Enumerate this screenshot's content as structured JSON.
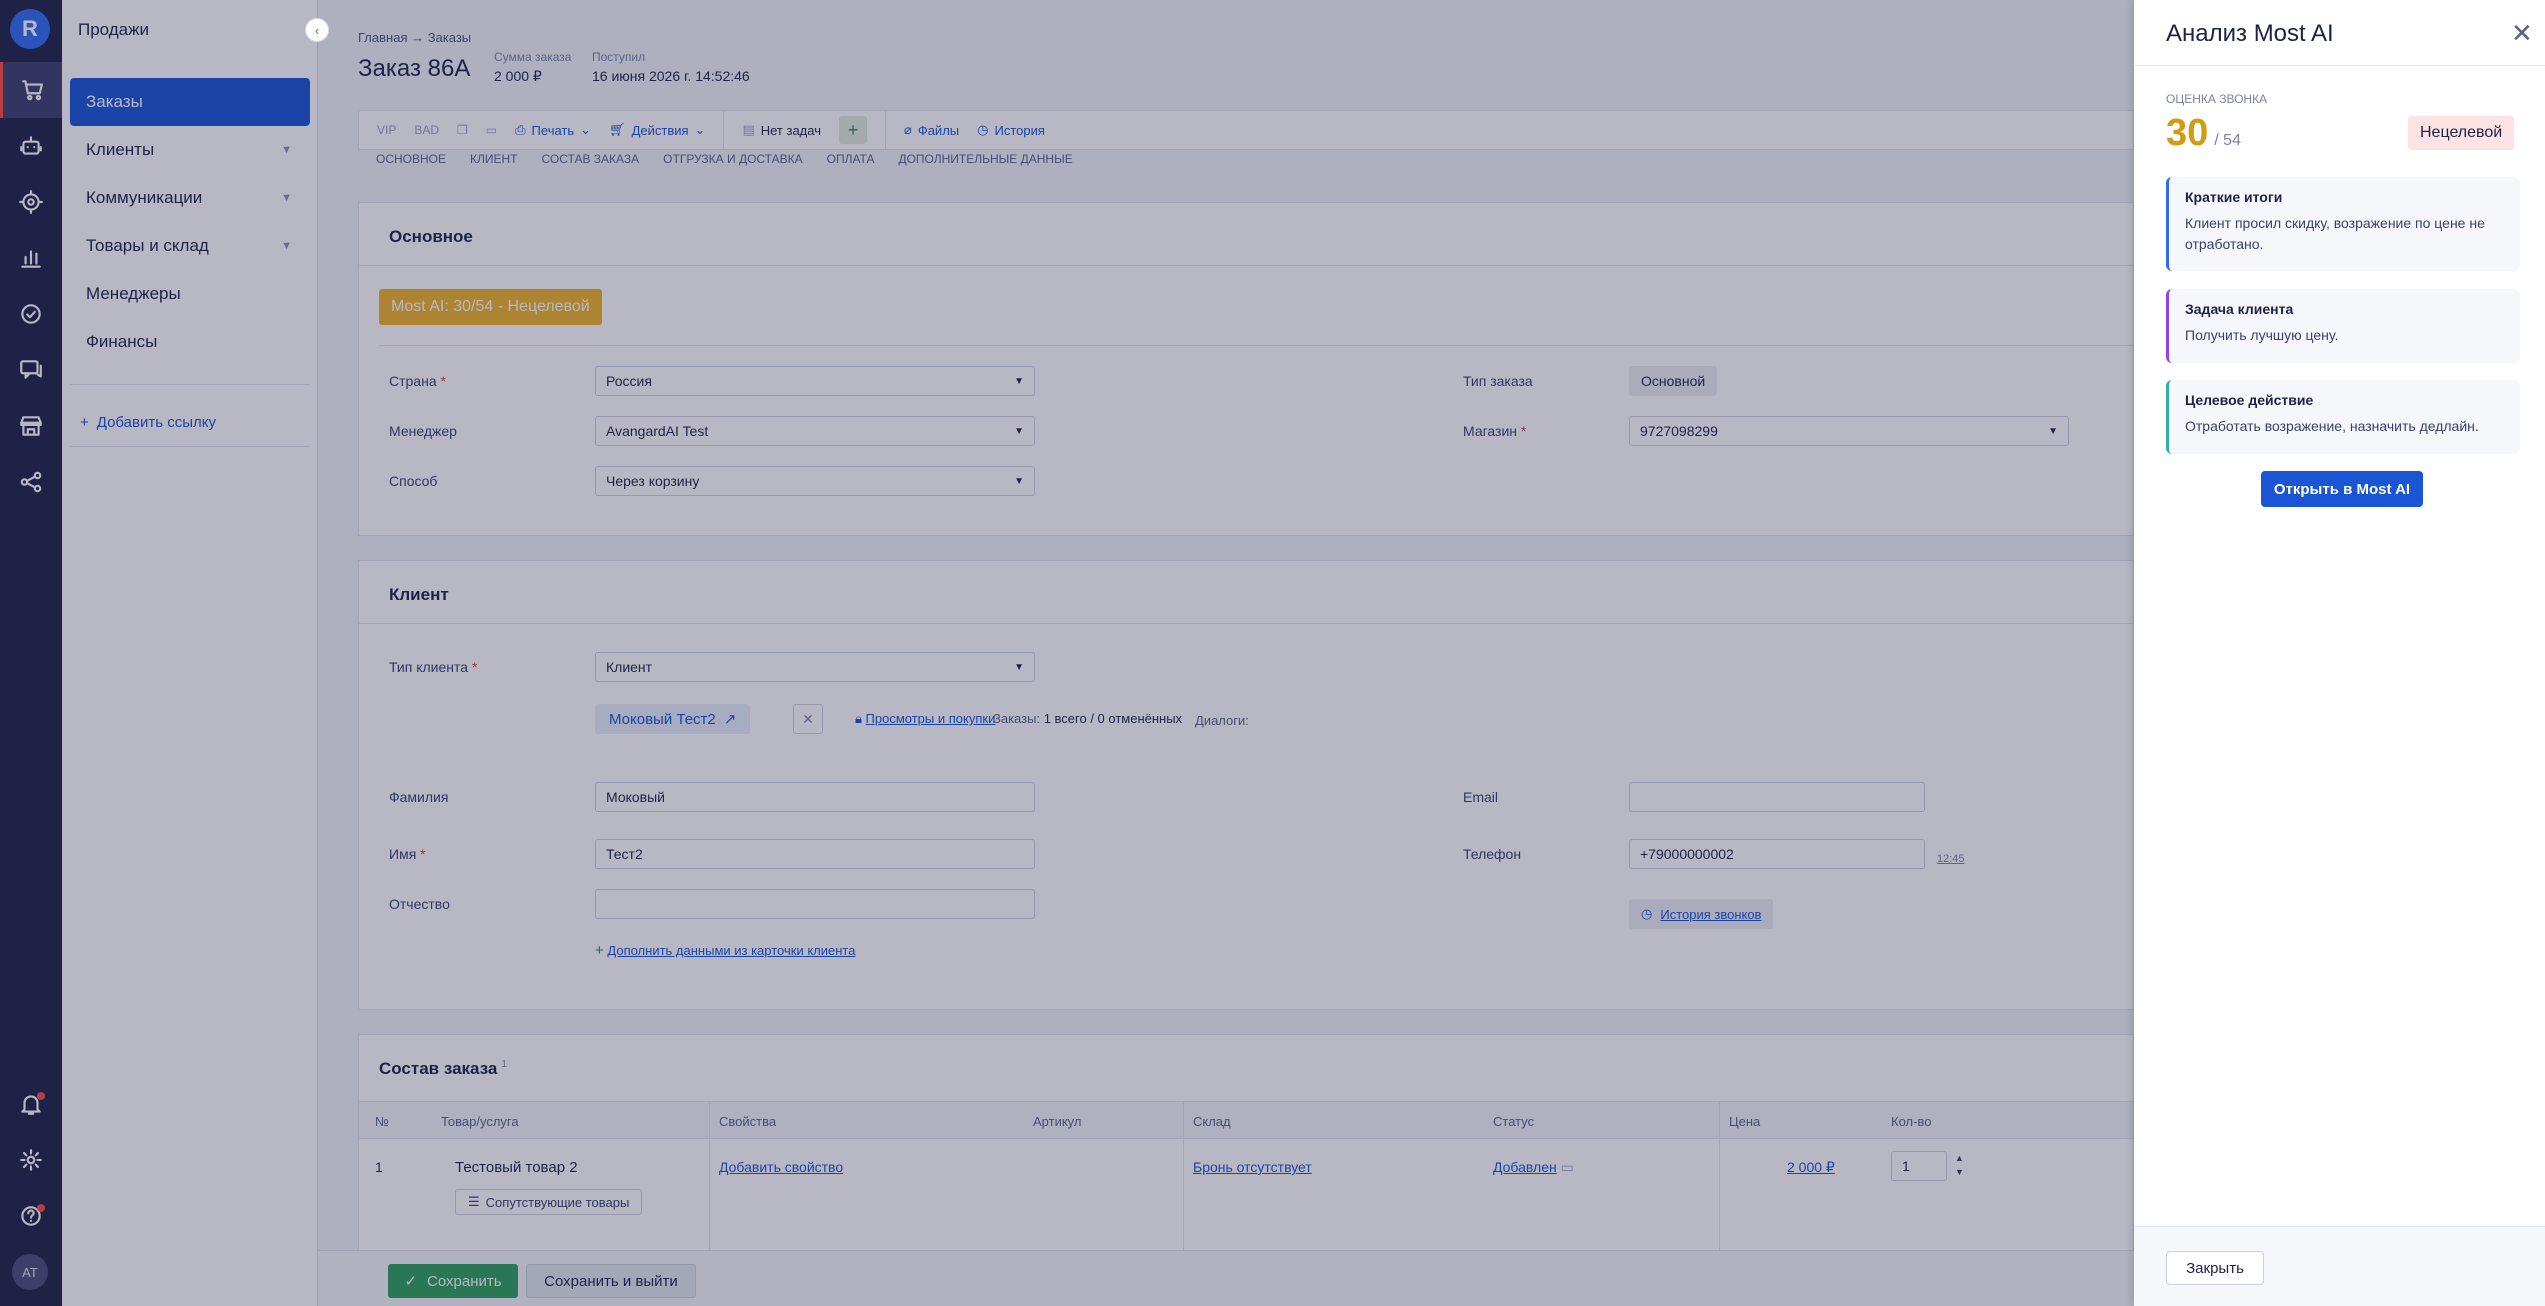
{
  "rail": {
    "items": [
      "cart-icon",
      "robot-icon",
      "target-icon",
      "chart-icon",
      "check-icon",
      "chat-icon",
      "store-icon",
      "share-icon"
    ],
    "bottom": [
      "bell-icon",
      "gear-icon",
      "help-icon"
    ],
    "avatar": "AT",
    "accent": "#ff4a4a"
  },
  "sidebar": {
    "title": "Продажи",
    "items": [
      {
        "label": "Заказы",
        "active": true
      },
      {
        "label": "Клиенты",
        "chevron": true
      },
      {
        "label": "Коммуникации",
        "chevron": true
      },
      {
        "label": "Товары и склад",
        "chevron": true
      },
      {
        "label": "Менеджеры"
      },
      {
        "label": "Финансы"
      }
    ],
    "add_link": "Добавить ссылку"
  },
  "header": {
    "breadcrumb": "Главная → Заказы",
    "title": "Заказ 86А",
    "sum_label": "Сумма заказа",
    "sum_value": "2 000 ₽",
    "received_label": "Поступил",
    "received_value": "16 июня 2026 г. 14:52:46"
  },
  "toolbar": {
    "vip": "VIP",
    "bad": "BAD",
    "print": "Печать",
    "actions": "Действия",
    "no_tasks": "Нет задач",
    "plus": "+",
    "files": "Файлы",
    "history": "История"
  },
  "tabs": [
    "Основное",
    "Клиент",
    "Состав заказа",
    "Отгрузка и доставка",
    "Оплата",
    "Дополнительные данные"
  ],
  "main_card": {
    "title": "Основное",
    "badge": "Most AI: 30/54 - Нецелевой",
    "country_label": "Страна",
    "country_value": "Россия",
    "manager_label": "Менеджер",
    "manager_value": "AvangardAI Test",
    "method_label": "Способ",
    "method_value": "Через корзину",
    "order_type_label": "Тип заказа",
    "order_type_value": "Основной",
    "shop_label": "Магазин",
    "shop_value": "9727098299"
  },
  "client_card": {
    "title": "Клиент",
    "type_label": "Тип клиента",
    "type_value": "Клиент",
    "client_chip": "Моковый Тест2",
    "views_link": "Просмотры и покупки",
    "orders_label": "Заказы:",
    "orders_value": "1 всего / 0 отменённых",
    "dialogs_label": "Диалоги:",
    "last_name_label": "Фамилия",
    "last_name_value": "Моковый",
    "first_name_label": "Имя",
    "first_name_value": "Тест2",
    "middle_name_label": "Отчество",
    "middle_name_value": "",
    "email_label": "Email",
    "email_value": "",
    "phone_label": "Телефон",
    "phone_value": "+79000000002",
    "phone_time": "12:45",
    "calls_history": "История звонков",
    "fill_link": "Дополнить данными из карточки клиента"
  },
  "items_card": {
    "title": "Состав заказа",
    "title_sup": "1",
    "columns": [
      "№",
      "Товар/услуга",
      "Свойства",
      "Артикул",
      "Склад",
      "Статус",
      "Цена",
      "Кол-во"
    ],
    "row": {
      "num": "1",
      "product": "Тестовый товар 2",
      "related": "Сопутствующие товары",
      "add_property": "Добавить свойство",
      "stock": "Бронь отсутствует",
      "status": "Добавлен",
      "price": "2 000 ₽",
      "qty": "1"
    }
  },
  "bottom": {
    "save": "Сохранить",
    "save_exit": "Сохранить и выйти"
  },
  "panel": {
    "title": "Анализ Most AI",
    "score_label": "Оценка звонка",
    "score": "30",
    "score_max": "/ 54",
    "tag": "Нецелевой",
    "cards": [
      {
        "heading": "Краткие итоги",
        "text": "Клиент просил скидку, возражение по цене не отработано.",
        "color": "#2f6cf0"
      },
      {
        "heading": "Задача клиента",
        "text": "Получить лучшую цену.",
        "color": "#8e44ec"
      },
      {
        "heading": "Целевое действие",
        "text": "Отработать возражение, назначить дедлайн.",
        "color": "#2bb3a0"
      }
    ],
    "open_button": "Открыть в Most AI",
    "close_button": "Закрыть"
  }
}
